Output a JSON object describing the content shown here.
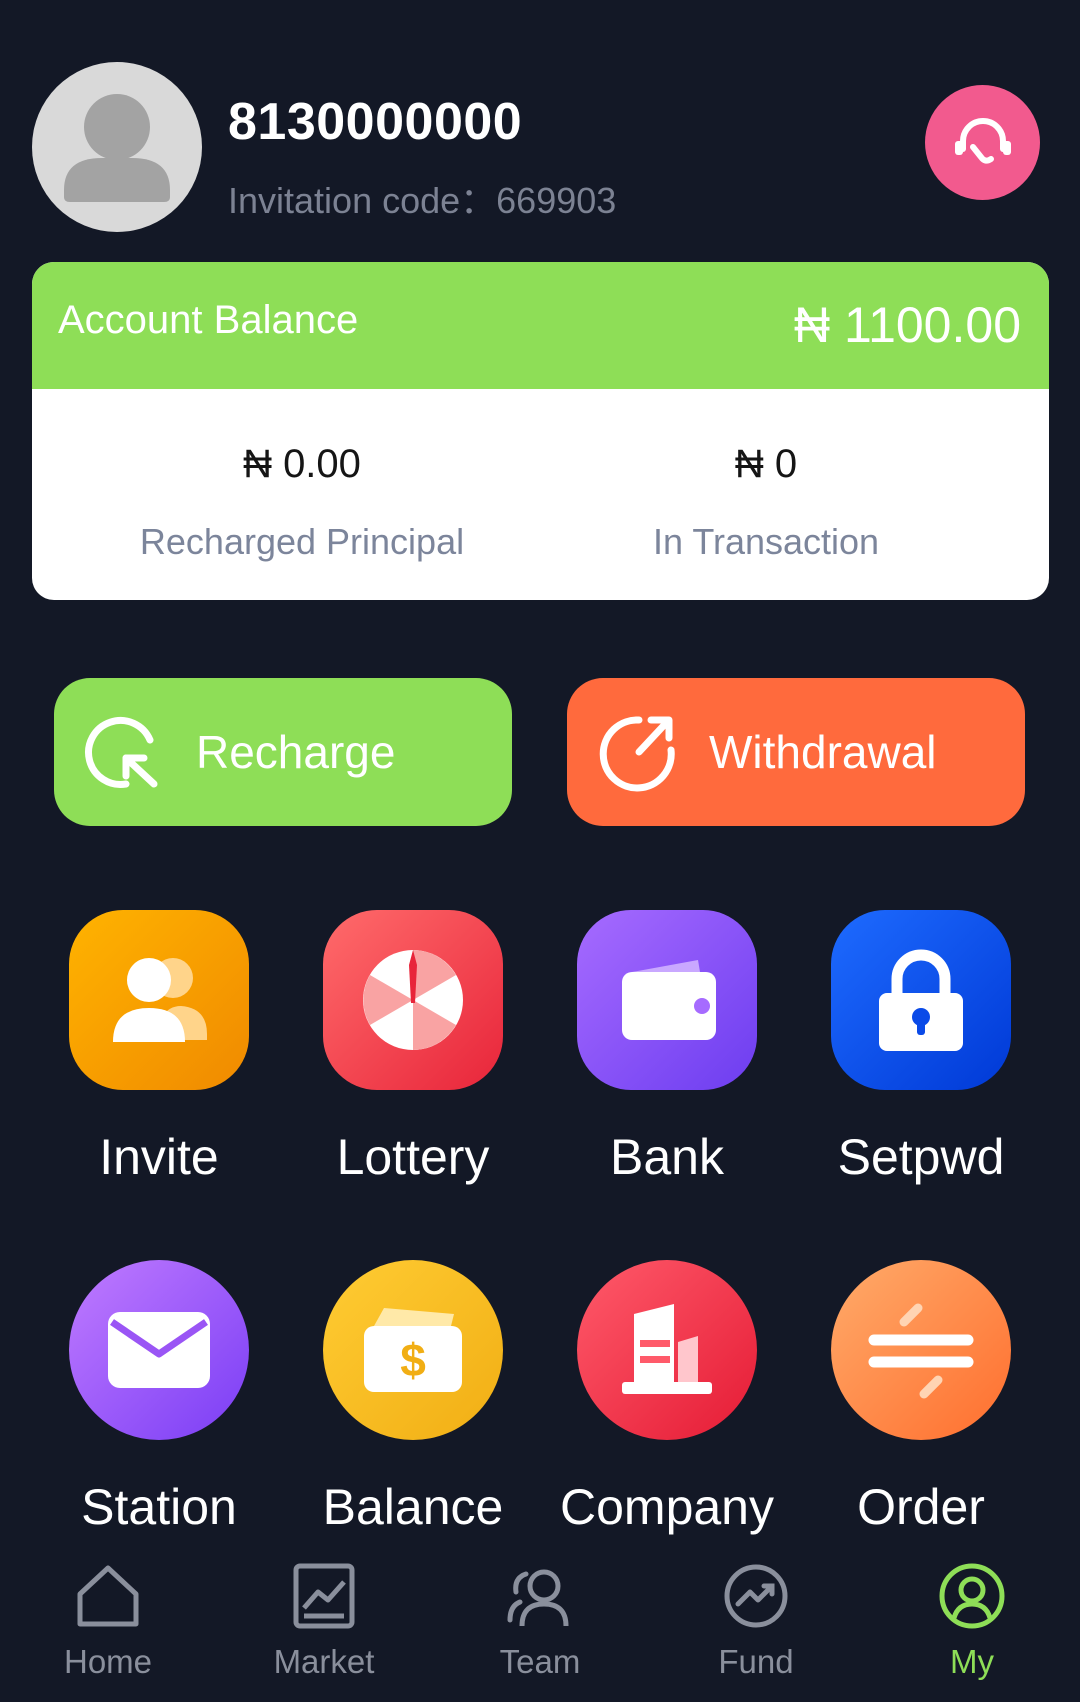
{
  "user": {
    "phone": "8130000000",
    "invitation_code": "Invitation code：669903"
  },
  "balance_card": {
    "title": "Account Balance",
    "amount": "₦ 1100.00",
    "recharged_principal_value": "₦ 0.00",
    "recharged_principal_label": "Recharged Principal",
    "in_transaction_value": "₦ 0",
    "in_transaction_label": "In Transaction"
  },
  "actions": {
    "recharge_label": "Recharge",
    "withdrawal_label": "Withdrawal"
  },
  "grid": [
    {
      "label": "Invite",
      "icon": "people-icon"
    },
    {
      "label": "Lottery",
      "icon": "wheel-icon"
    },
    {
      "label": "Bank",
      "icon": "wallet-icon"
    },
    {
      "label": "Setpwd",
      "icon": "lock-icon"
    },
    {
      "label": "Station",
      "icon": "envelope-icon"
    },
    {
      "label": "Balance",
      "icon": "money-icon"
    },
    {
      "label": "Company",
      "icon": "building-icon"
    },
    {
      "label": "Order",
      "icon": "exchange-icon"
    }
  ],
  "tabbar": [
    {
      "label": "Home",
      "icon": "home-icon"
    },
    {
      "label": "Market",
      "icon": "chart-icon"
    },
    {
      "label": "Team",
      "icon": "team-icon"
    },
    {
      "label": "Fund",
      "icon": "fund-icon"
    },
    {
      "label": "My",
      "icon": "user-icon",
      "active": true
    }
  ],
  "colors": {
    "background": "#131826",
    "green": "#8ede57",
    "orange": "#ff6a3d",
    "support_pink": "#f25a8e",
    "active_tab": "#8ede57"
  }
}
